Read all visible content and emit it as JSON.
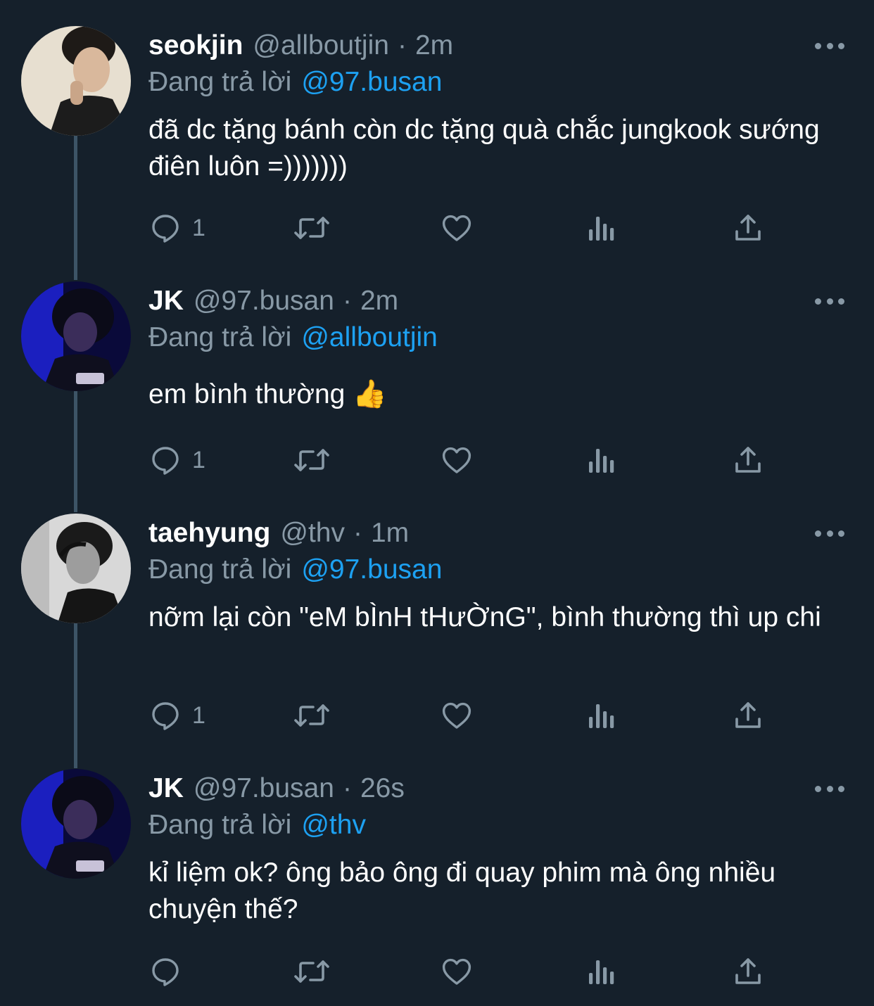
{
  "tweets": [
    {
      "name": "seokjin",
      "handle": "@allboutjin",
      "separator": "·",
      "time": "2m",
      "replying_label": "Đang trả lời",
      "replying_to": "@97.busan",
      "text": "đã dc tặng bánh còn dc tặng quà chắc jungkook sướng điên luôn =)))))))",
      "reply_count": "1",
      "avatar_icon": "profile-photo"
    },
    {
      "name": "JK",
      "handle": "@97.busan",
      "separator": "·",
      "time": "2m",
      "replying_label": "Đang trả lời",
      "replying_to": "@allboutjin",
      "text": "em bình thường 👍",
      "reply_count": "1",
      "avatar_icon": "profile-photo"
    },
    {
      "name": "taehyung",
      "handle": "@thv",
      "separator": "·",
      "time": "1m",
      "replying_label": "Đang trả lời",
      "replying_to": "@97.busan",
      "text": "nỡm lại còn \"eM bÌnH tHưỜnG\", bình thường thì up chi",
      "reply_count": "1",
      "avatar_icon": "profile-photo"
    },
    {
      "name": "JK",
      "handle": "@97.busan",
      "separator": "·",
      "time": "26s",
      "replying_label": "Đang trả lời",
      "replying_to": "@thv",
      "text": "kỉ liệm ok? ông bảo ông đi quay phim mà ông nhiều chuyện thế?",
      "reply_count": "",
      "avatar_icon": "profile-photo"
    }
  ],
  "icons": {
    "reply": "reply-icon",
    "retweet": "retweet-icon",
    "like": "like-icon",
    "stats": "stats-icon",
    "share": "share-icon",
    "more": "more-icon"
  },
  "colors": {
    "background": "#15202b",
    "text": "#ffffff",
    "muted": "#8899a6",
    "link": "#1da1f2",
    "thread_line": "#3d5466"
  }
}
